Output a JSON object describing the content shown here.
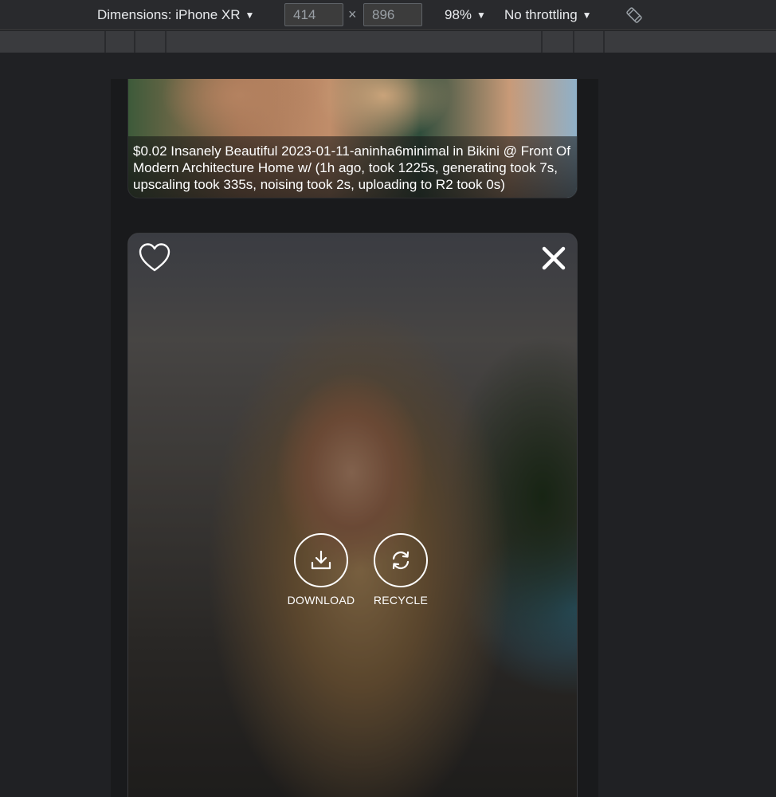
{
  "toolbar": {
    "device_label": "Dimensions: iPhone XR",
    "width_value": "414",
    "height_value": "896",
    "times_symbol": "×",
    "zoom": "98%",
    "throttle": "No throttling"
  },
  "feed": {
    "card1": {
      "caption": "$0.02 Insanely Beautiful 2023-01-11-aninha6minimal in Bikini @ Front Of Modern Architecture Home w/ (1h ago, took 1225s, generating took 7s, upscaling took 335s, noising took 2s, uploading to R2 took 0s)"
    },
    "card2": {
      "download_label": "DOWNLOAD",
      "recycle_label": "RECYCLE"
    }
  },
  "icons": {
    "favorite": "heart-outline-icon",
    "close": "close-x-icon",
    "download": "download-icon",
    "recycle": "refresh-icon",
    "rotate": "rotate-device-icon"
  }
}
